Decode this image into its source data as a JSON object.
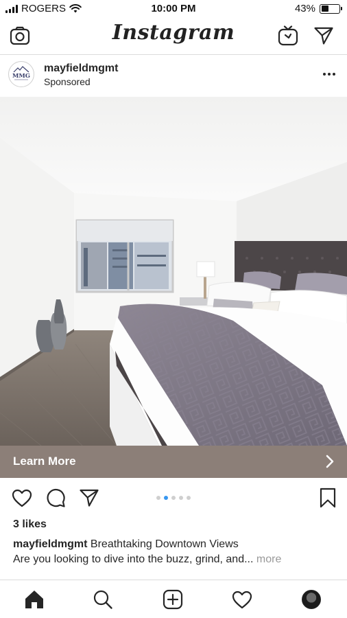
{
  "status_bar": {
    "carrier": "ROGERS",
    "time": "10:00 PM",
    "battery_percent": "43%",
    "battery_level": 0.43,
    "signal_icon": "cellular-signal-icon",
    "wifi_icon": "wifi-icon"
  },
  "header": {
    "logo": "Instagram",
    "left_icon": "camera-icon",
    "right_icons": [
      "igtv-icon",
      "direct-message-icon"
    ]
  },
  "post": {
    "username": "mayfieldmgmt",
    "label": "Sponsored",
    "avatar_text": "MMG",
    "more_icon": "more-options-icon",
    "image_description_icon": "bedroom-photo",
    "cta": {
      "label": "Learn More",
      "icon": "chevron-right-icon"
    },
    "carousel": {
      "count": 5,
      "active_index": 1
    },
    "likes": "3 likes",
    "caption": {
      "username": "mayfieldmgmt",
      "title": "Breathtaking Downtown Views",
      "body": "Are you looking to dive into the buzz, grind, and...",
      "more": "more"
    }
  },
  "action_icons": [
    "heart-icon",
    "comment-icon",
    "share-icon",
    "bookmark-icon"
  ],
  "tab_bar": [
    "home-icon",
    "search-icon",
    "new-post-icon",
    "activity-icon",
    "profile-icon"
  ],
  "colors": {
    "cta_background": "#8c7f78",
    "active_dot": "#3897f0",
    "inactive_dot": "#cfcfcf",
    "text": "#262626",
    "divider": "#dbdbdb"
  }
}
